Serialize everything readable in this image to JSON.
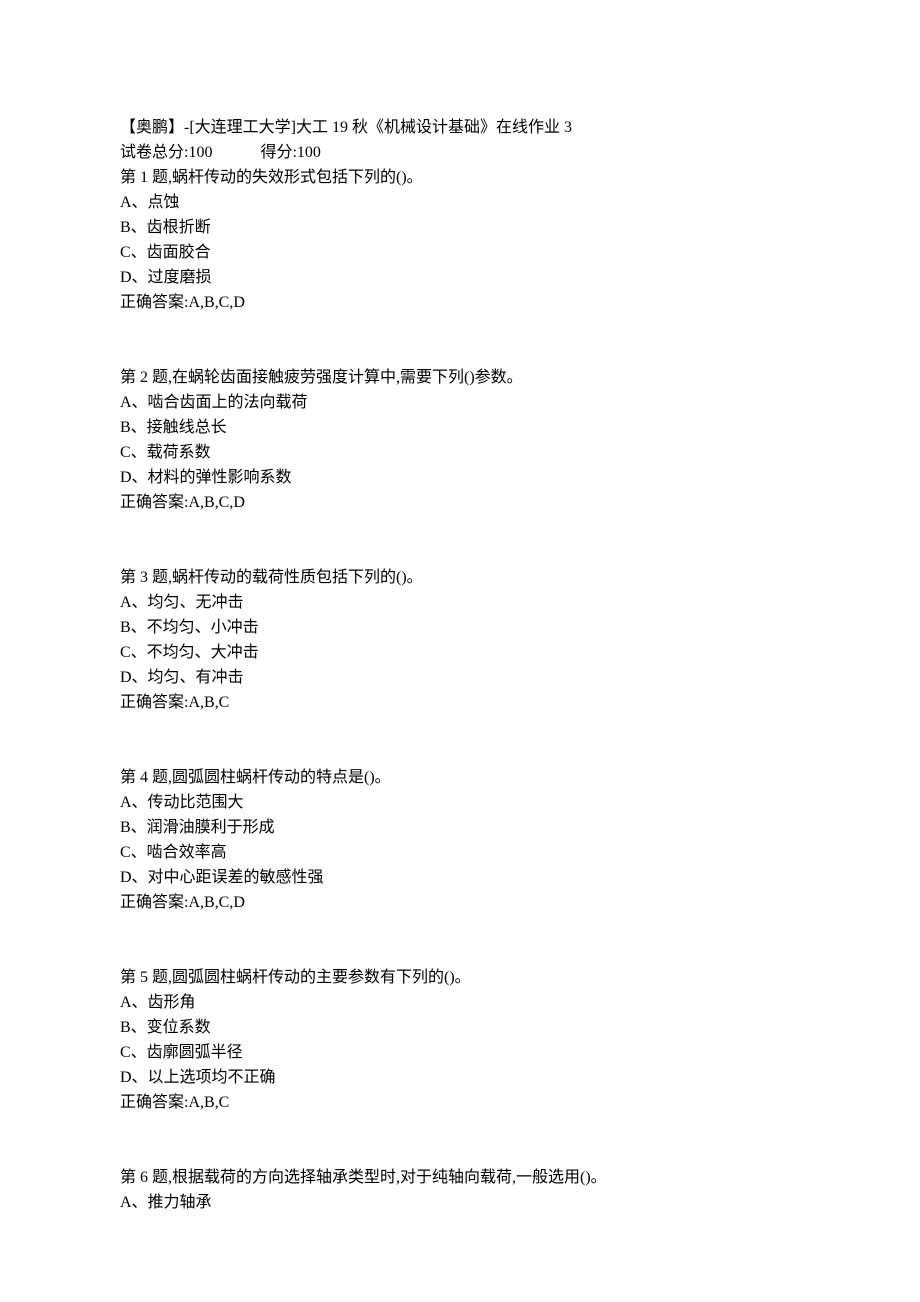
{
  "header": {
    "title": "【奥鹏】-[大连理工大学]大工 19 秋《机械设计基础》在线作业 3",
    "total_label": "试卷总分:100",
    "score_label": "得分:100"
  },
  "questions": [
    {
      "stem": "第 1 题,蜗杆传动的失效形式包括下列的()。",
      "options": [
        "A、点蚀",
        "B、齿根折断",
        "C、齿面胶合",
        "D、过度磨损"
      ],
      "answer": "正确答案:A,B,C,D"
    },
    {
      "stem": "第 2 题,在蜗轮齿面接触疲劳强度计算中,需要下列()参数。",
      "options": [
        "A、啮合齿面上的法向载荷",
        "B、接触线总长",
        "C、载荷系数",
        "D、材料的弹性影响系数"
      ],
      "answer": "正确答案:A,B,C,D"
    },
    {
      "stem": "第 3 题,蜗杆传动的载荷性质包括下列的()。",
      "options": [
        "A、均匀、无冲击",
        "B、不均匀、小冲击",
        "C、不均匀、大冲击",
        "D、均匀、有冲击"
      ],
      "answer": "正确答案:A,B,C"
    },
    {
      "stem": "第 4 题,圆弧圆柱蜗杆传动的特点是()。",
      "options": [
        "A、传动比范围大",
        "B、润滑油膜利于形成",
        "C、啮合效率高",
        "D、对中心距误差的敏感性强"
      ],
      "answer": "正确答案:A,B,C,D"
    },
    {
      "stem": "第 5 题,圆弧圆柱蜗杆传动的主要参数有下列的()。",
      "options": [
        "A、齿形角",
        "B、变位系数",
        "C、齿廓圆弧半径",
        "D、以上选项均不正确"
      ],
      "answer": "正确答案:A,B,C"
    },
    {
      "stem": "第 6 题,根据载荷的方向选择轴承类型时,对于纯轴向载荷,一般选用()。",
      "options": [
        "A、推力轴承"
      ],
      "answer": ""
    }
  ]
}
